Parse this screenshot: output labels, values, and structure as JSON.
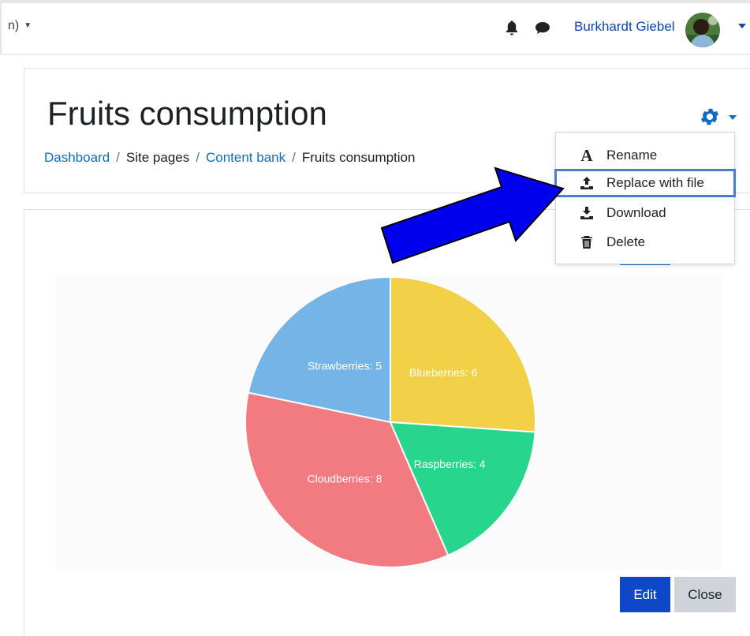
{
  "topbar": {
    "language_fragment": "n)",
    "user_name": "Burkhardt Giebel",
    "icons": [
      "bell-icon",
      "chat-icon",
      "avatar",
      "chevron-down-icon"
    ]
  },
  "header": {
    "title": "Fruits consumption",
    "breadcrumb": [
      {
        "label": "Dashboard",
        "link": true
      },
      {
        "label": "Site pages",
        "link": false
      },
      {
        "label": "Content bank",
        "link": true
      },
      {
        "label": "Fruits consumption",
        "link": false
      }
    ]
  },
  "actions_menu": {
    "icon": "gear-icon",
    "items": [
      {
        "label": "Rename",
        "icon": "rename-icon"
      },
      {
        "label": "Replace with file",
        "icon": "upload-icon",
        "highlighted": true
      },
      {
        "label": "Download",
        "icon": "download-icon"
      },
      {
        "label": "Delete",
        "icon": "trash-icon"
      }
    ]
  },
  "chart_data": {
    "type": "pie",
    "title": "",
    "categories": [
      "Blueberries",
      "Raspberries",
      "Cloudberries",
      "Strawberries"
    ],
    "values": [
      6,
      4,
      8,
      5
    ],
    "labels": [
      "Blueberries: 6",
      "Raspberries: 4",
      "Cloudberries: 8",
      "Strawberries: 5"
    ],
    "colors": [
      "#f2d048",
      "#27d68c",
      "#f27b82",
      "#74b4e6"
    ]
  },
  "footer_buttons": {
    "edit": "Edit",
    "close": "Close"
  },
  "colors": {
    "link": "#0f6cbf",
    "primary": "#0f47c9",
    "annotation_arrow": "#0000ee",
    "highlight_outline": "#4a7ec9"
  }
}
